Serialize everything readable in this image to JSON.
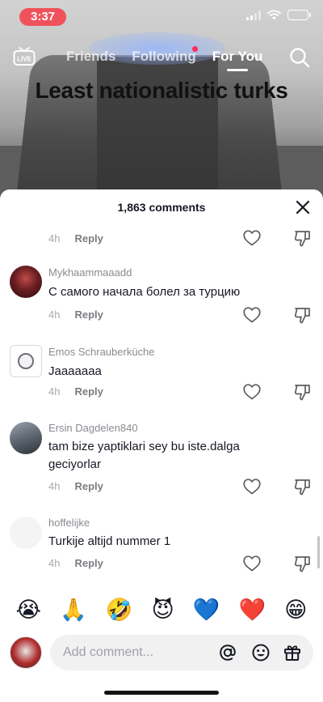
{
  "status_bar": {
    "time": "3:37",
    "battery_level": 0.3,
    "icons": [
      "signal-icon",
      "wifi-icon",
      "battery-icon"
    ]
  },
  "top_nav": {
    "live_icon": "live-tv-icon",
    "tabs": [
      {
        "label": "Friends",
        "active": false
      },
      {
        "label": "Following",
        "active": false
      },
      {
        "label": "For You",
        "active": true
      }
    ],
    "search_icon": "search-icon"
  },
  "video": {
    "caption": "Least nationalistic turks"
  },
  "comments_sheet": {
    "header": "1,863 comments",
    "close_icon": "close-icon",
    "comments": [
      {
        "username": "",
        "text": "",
        "time": "4h",
        "reply_label": "Reply"
      },
      {
        "username": "Mykhaammaaadd",
        "text": "С самого начала болел за турцию",
        "time": "4h",
        "reply_label": "Reply"
      },
      {
        "username": "Emos Schrauberküche",
        "text": "Jaaaaaaa",
        "time": "4h",
        "reply_label": "Reply"
      },
      {
        "username": "Ersin Dagdelen840",
        "text": "tam bize yaptiklari sey bu iste.dalga geciyorlar",
        "time": "4h",
        "reply_label": "Reply"
      },
      {
        "username": "hoffelijke",
        "text": "Turkije altijd nummer 1",
        "time": "4h",
        "reply_label": "Reply"
      }
    ]
  },
  "emoji_bar": [
    "😭",
    "🙏",
    "🤣",
    "😈",
    "💙",
    "❤️",
    "😁"
  ],
  "composer": {
    "placeholder": "Add comment...",
    "icons": [
      "mention-icon",
      "emoji-icon",
      "gift-icon"
    ]
  },
  "colors": {
    "accent": "#fe2c55",
    "time_pill": "#f0525b",
    "muted_text": "#8a8b91"
  }
}
